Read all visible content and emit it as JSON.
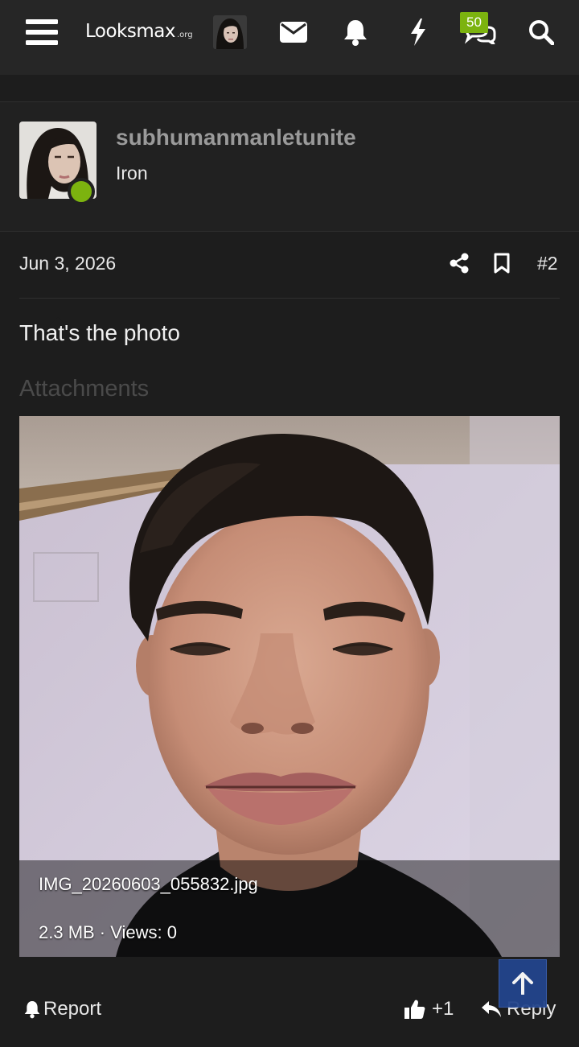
{
  "nav": {
    "logo_main": "Looksmax",
    "logo_tld": ".org",
    "chat_badge": "50",
    "icons": [
      "menu-icon",
      "user-avatar",
      "mail-icon",
      "bell-icon",
      "bolt-icon",
      "chat-icon",
      "search-icon"
    ]
  },
  "user": {
    "name": "subhumanmanletunite",
    "title": "Iron",
    "status": "online",
    "status_color": "#7cb30f"
  },
  "post": {
    "date": "Jun 3, 2026",
    "number": "#2",
    "text": "That's the photo",
    "attachments_heading": "Attachments"
  },
  "attachment": {
    "filename": "IMG_20260603_055832.jpg",
    "meta": "2.3 MB · Views: 0"
  },
  "actions": {
    "report": "Report",
    "like": "+1",
    "reply": "Reply"
  },
  "colors": {
    "accent": "#7cb30f",
    "scroll_top": "#23458c",
    "background": "#1d1d1d",
    "panel": "#262626"
  }
}
